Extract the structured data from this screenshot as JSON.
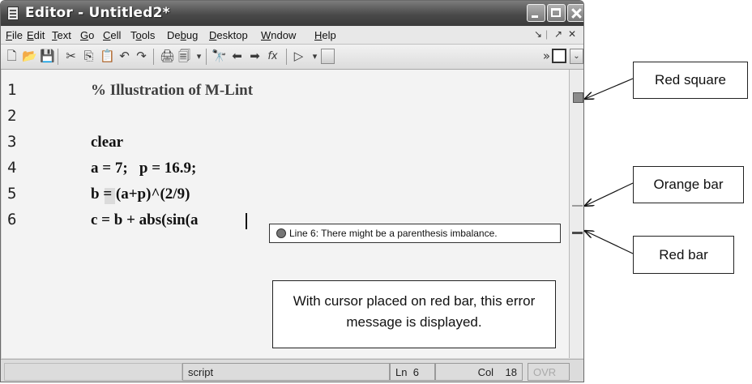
{
  "window": {
    "title": "Editor - Untitled2*"
  },
  "menubar": {
    "items": [
      {
        "underline": "F",
        "rest": "ile"
      },
      {
        "underline": "E",
        "rest": "dit"
      },
      {
        "underline": "T",
        "rest": "ext"
      },
      {
        "underline": "G",
        "rest": "o"
      },
      {
        "underline": "C",
        "rest": "ell"
      },
      {
        "prefix": "T",
        "underline": "o",
        "rest": "ols"
      },
      {
        "prefix": "De",
        "underline": "b",
        "rest": "ug"
      },
      {
        "underline": "D",
        "rest": "esktop"
      },
      {
        "underline": "W",
        "rest": "ndow"
      },
      {
        "underline": "H",
        "rest": "elp"
      }
    ],
    "dock_glyph": "↘",
    "undock_glyph": "↗",
    "close_glyph": "✕"
  },
  "toolbar": {
    "icons": [
      "new-file",
      "open-file",
      "save",
      "cut",
      "copy",
      "paste",
      "undo",
      "redo",
      "print",
      "print-preview",
      "find",
      "back",
      "forward",
      "function",
      "run",
      "stack"
    ],
    "glyphs": {
      "new": "🗋",
      "open": "📂",
      "save": "💾",
      "cut": "✂",
      "copy": "⎘",
      "paste": "📋",
      "undo": "↶",
      "redo": "↷",
      "print": "🖨",
      "preview": "🗐",
      "find": "🔭",
      "back": "⬅",
      "forward": "➡",
      "function": "fx",
      "run": "▷",
      "dropdown": "▾",
      "overflow": "»",
      "checkbox_dropdown": "⌄"
    }
  },
  "editor": {
    "line_numbers": [
      "1",
      "2",
      "3",
      "4",
      "5",
      "6"
    ],
    "lines": [
      "% Illustration of M-Lint",
      "",
      "clear",
      "a = 7;   p = 16.9;",
      "b = (a+p)^(2/9)",
      "c = b + abs(sin(a"
    ],
    "tooltip": "Line 6: There might be a parenthesis imbalance."
  },
  "statusbar": {
    "mode": "script",
    "ln_label": "Ln",
    "ln_value": "6",
    "col_label": "Col",
    "col_value": "18",
    "ovr": "OVR"
  },
  "annotations": {
    "red_square": "Red square",
    "orange_bar": "Orange bar",
    "red_bar": "Red bar",
    "message": "With cursor placed on red bar, this error message is displayed."
  }
}
